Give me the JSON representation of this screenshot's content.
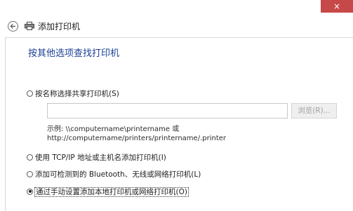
{
  "window": {
    "close_glyph": "×"
  },
  "header": {
    "title": "添加打印机",
    "back_icon": "back-arrow-icon",
    "printer_icon": "printer-icon"
  },
  "main": {
    "heading": "按其他选项查找打印机",
    "options": [
      {
        "label": "按名称选择共享打印机(S)",
        "checked": false
      },
      {
        "label": "使用 TCP/IP 地址或主机名添加打印机(I)",
        "checked": false
      },
      {
        "label": "添加可检测到的 Bluetooth、无线或网络打印机(L)",
        "checked": false
      },
      {
        "label": "通过手动设置添加本地打印机或网络打印机(O)",
        "checked": true
      }
    ],
    "share_input": {
      "value": "",
      "placeholder": ""
    },
    "browse_label": "浏览(R)...",
    "example_line1": "示例: \\\\computername\\printername 或",
    "example_line2": "http://computername/printers/printername/.printer"
  },
  "colors": {
    "accent": "#1c3f94",
    "close": "#c74848"
  }
}
